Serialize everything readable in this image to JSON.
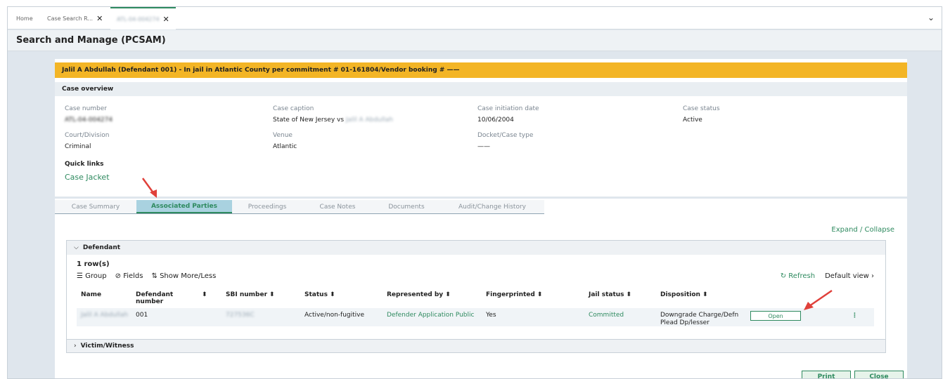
{
  "tabs": [
    {
      "label": "Home"
    },
    {
      "label": "Case Search R...",
      "close": "✕"
    },
    {
      "label": "ATL-04-004274",
      "close": "✕"
    }
  ],
  "window_chevron": "⌄",
  "page_title": "Search and Manage (PCSAM)",
  "banner": "Jalil A Abdullah (Defendant 001) - In jail in Atlantic County per commitment # 01-161804/Vendor booking # ——",
  "overview": {
    "heading": "Case overview",
    "fields": [
      {
        "label": "Case number",
        "value": "ATL-04-004274"
      },
      {
        "label": "Case caption",
        "value_prefix": "State of New Jersey vs",
        "value_blur": "Jalil A Abdullah"
      },
      {
        "label": "Case initiation date",
        "value": "10/06/2004"
      },
      {
        "label": "Case status",
        "value": "Active"
      },
      {
        "label": "Court/Division",
        "value": "Criminal"
      },
      {
        "label": "Venue",
        "value": "Atlantic"
      },
      {
        "label": "Docket/Case type",
        "value": "——"
      }
    ],
    "quick_links_label": "Quick links",
    "quick_link": "Case Jacket"
  },
  "case_tabs": [
    "Case Summary",
    "Associated Parties",
    "Proceedings",
    "Case Notes",
    "Documents",
    "Audit/Change History"
  ],
  "expand_collapse": "Expand / Collapse",
  "defendant": {
    "heading": "Defendant",
    "rows_count": "1 row(s)",
    "toolbar": {
      "group": "Group",
      "fields": "Fields",
      "show": "Show More/Less",
      "refresh": "Refresh",
      "view": "Default view"
    },
    "columns": [
      "Name",
      "Defendant number",
      "SBI number",
      "Status",
      "Represented by",
      "Fingerprinted",
      "Jail status",
      "Disposition"
    ],
    "row": {
      "name": "Jalil A Abdullah",
      "defendant_number": "001",
      "sbi": "727536C",
      "status": "Active/non-fugitive",
      "represented_by": "Defender Application Public",
      "fingerprinted": "Yes",
      "jail_status": "Committed",
      "disposition": "Downgrade Charge/Defn Plead Dp/lesser",
      "open_label": "Open"
    }
  },
  "victim_witness": "Victim/Witness",
  "buttons": {
    "print": "Print",
    "close": "Close"
  },
  "colors": {
    "accent": "#2e8a5f",
    "banner": "#f3b526",
    "arrow": "#e0403a"
  }
}
